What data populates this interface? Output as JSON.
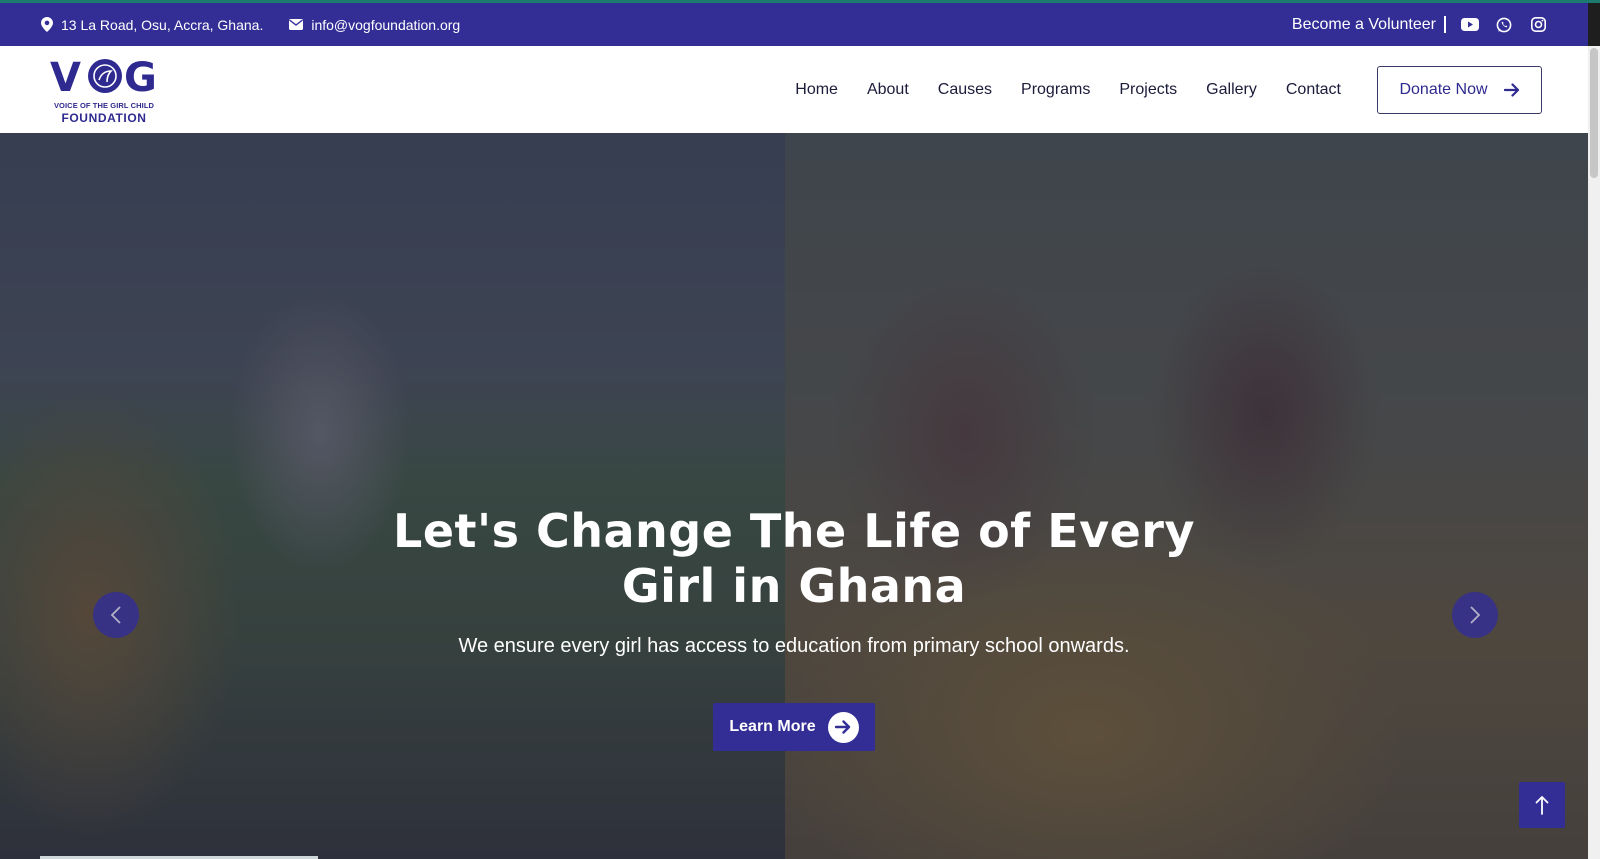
{
  "topbar": {
    "address": "13 La Road, Osu, Accra, Ghana.",
    "email": "info@vogfoundation.org",
    "volunteer_label": "Become a Volunteer",
    "social_icons": [
      "youtube-icon",
      "whatsapp-icon",
      "instagram-icon"
    ]
  },
  "brand": {
    "logo_text": "VOG",
    "tagline": "VOICE OF THE GIRL CHILD",
    "foundation": "FOUNDATION"
  },
  "nav": {
    "items": [
      {
        "label": "Home"
      },
      {
        "label": "About"
      },
      {
        "label": "Causes"
      },
      {
        "label": "Programs"
      },
      {
        "label": "Projects"
      },
      {
        "label": "Gallery"
      },
      {
        "label": "Contact"
      }
    ],
    "donate_label": "Donate Now"
  },
  "hero": {
    "headline_line1": "Let's Change The Life of Every",
    "headline_line2": "Girl in Ghana",
    "subtitle": "We ensure every girl has access to education from primary school onwards.",
    "cta_label": "Learn More"
  },
  "colors": {
    "brand_primary": "#332e96",
    "topstrip": "#1c7a6e",
    "nav_text": "#1b1b3a"
  }
}
